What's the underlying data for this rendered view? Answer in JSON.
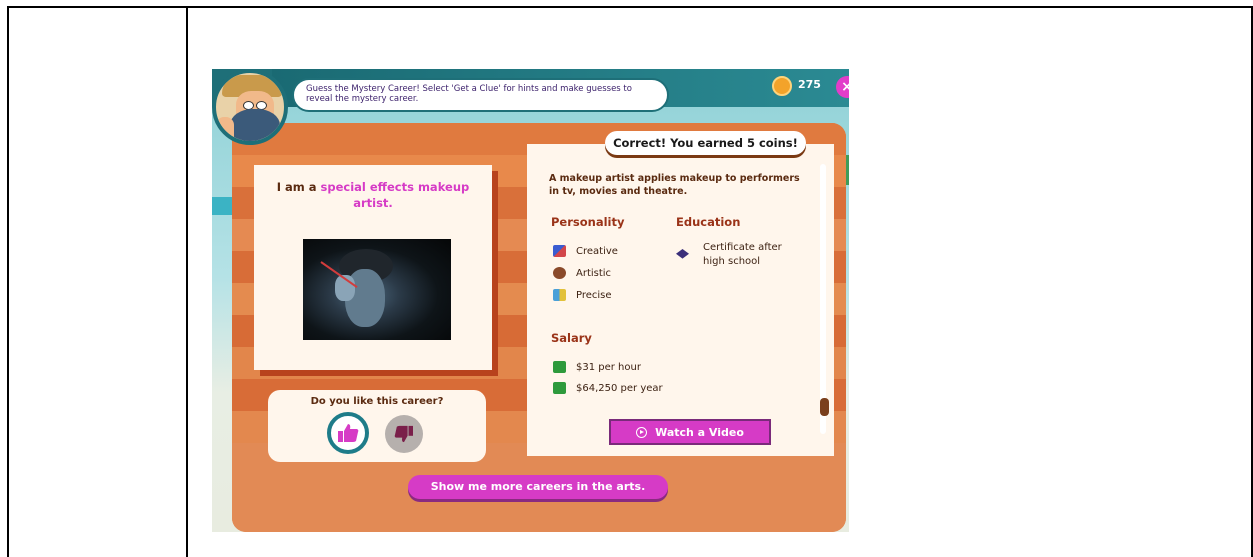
{
  "instruction": "Guess the Mystery Career! Select 'Get a Clue' for hints and make guesses to reveal the mystery career.",
  "coins": "275",
  "close_label": "×",
  "career": {
    "prefix": "I am a ",
    "name": "special effects makeup artist."
  },
  "like_question": "Do you like this career?",
  "correct_message": "Correct! You earned 5 coins!",
  "description": "A makeup artist applies makeup to performers in tv, movies and theatre.",
  "personality": {
    "title": "Personality",
    "items": [
      "Creative",
      "Artistic",
      "Precise"
    ]
  },
  "education": {
    "title": "Education",
    "items": [
      "Certificate after high school"
    ]
  },
  "salary": {
    "title": "Salary",
    "items": [
      "$31 per hour",
      "$64,250 per year"
    ]
  },
  "watch_video_label": "Watch a Video",
  "more_careers_label": "Show me more careers in the arts.",
  "colors": {
    "accent_pink": "#d63bc6",
    "teal": "#1e6f78",
    "board_orange": "#e07a3f"
  }
}
